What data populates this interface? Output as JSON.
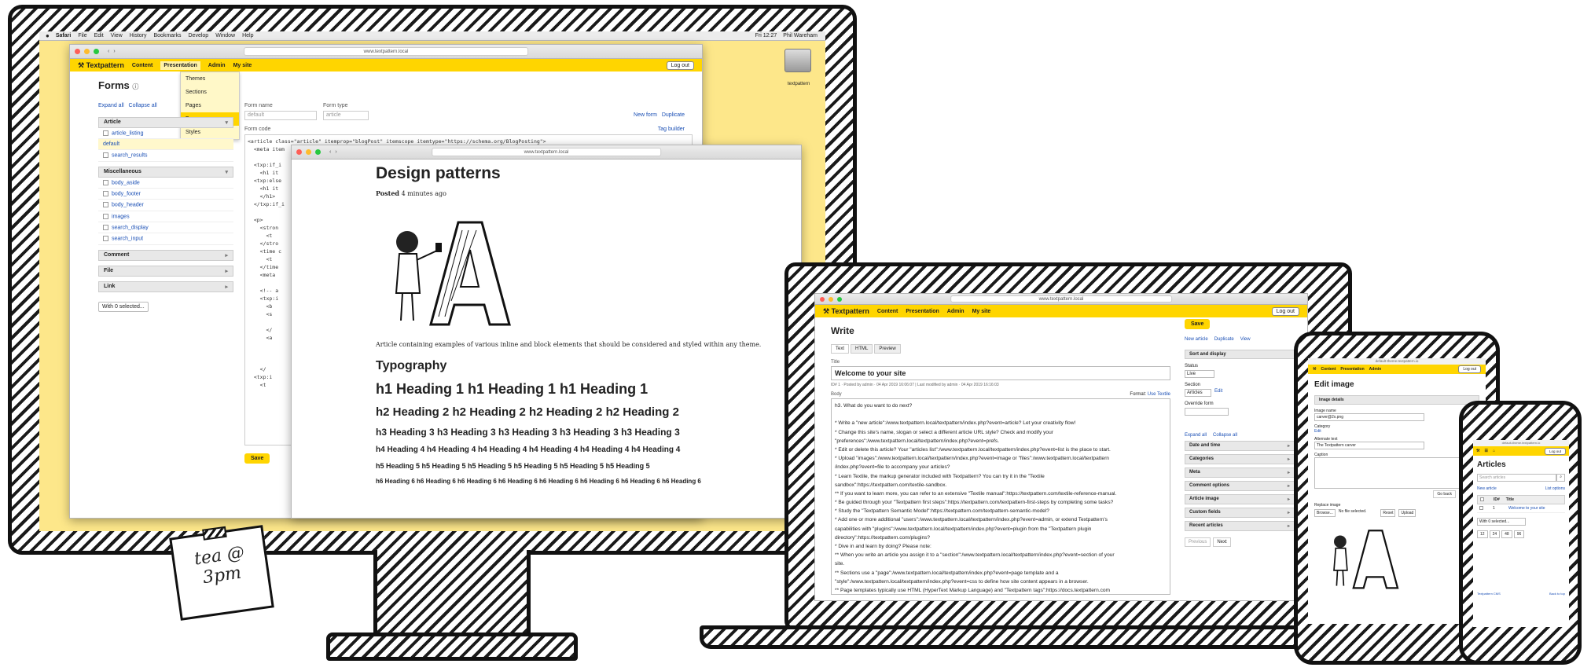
{
  "mac": {
    "menubar": [
      "Safari",
      "File",
      "Edit",
      "View",
      "History",
      "Bookmarks",
      "Develop",
      "Window",
      "Help"
    ],
    "clock": "Fri 12:27",
    "user": "Phil Wareham",
    "disk_label": "textpattern",
    "url_forms": "www.textpattern.local",
    "url_design": "www.textpattern.local"
  },
  "txp": {
    "logo": "Textpattern",
    "nav": [
      "Content",
      "Presentation",
      "Admin",
      "My site"
    ],
    "logout": "Log out",
    "presentation_menu": [
      "Themes",
      "Sections",
      "Pages",
      "Forms",
      "Styles"
    ]
  },
  "forms": {
    "title": "Forms",
    "expand_all": "Expand all",
    "collapse_all": "Collapse all",
    "groups": [
      {
        "name": "Article",
        "items": [
          "article_listing",
          "default",
          "search_results"
        ]
      },
      {
        "name": "Miscellaneous",
        "items": [
          "body_aside",
          "body_footer",
          "body_header",
          "images",
          "search_display",
          "search_input"
        ]
      },
      {
        "name": "Comment",
        "items": []
      },
      {
        "name": "File",
        "items": []
      },
      {
        "name": "Link",
        "items": []
      }
    ],
    "with_selected": "With 0 selected...",
    "form_name_label": "Form name",
    "form_name_value": "default",
    "form_type_label": "Form type",
    "form_type_value": "article",
    "new_form": "New form",
    "duplicate": "Duplicate",
    "form_code_label": "Form code",
    "tag_builder": "Tag builder",
    "code_lines": [
      "<article class=\"article\" itemprop=\"blogPost\" itemscope itemtype=\"https://schema.org/BlogPosting\">",
      "  <meta item",
      "",
      "  <txp:if_i",
      "    <h1 it",
      "  <txp:else",
      "    <h1 it",
      "    </h1>",
      "  </txp:if_i",
      "",
      "  <p>",
      "    <stron",
      "      <t",
      "    </stro",
      "    <time c",
      "      <t",
      "    </time",
      "    <meta",
      "",
      "    <!-- a",
      "    <txp:i",
      "      <b",
      "      <s",
      "",
      "      </",
      "      <a",
      "",
      "",
      "",
      "    </",
      "  <txp:i",
      "    <t"
    ],
    "save": "Save"
  },
  "design": {
    "title": "Design patterns",
    "posted_label": "Posted",
    "posted_time": "4 minutes ago",
    "excerpt": "Article containing examples of various inline and block elements that should be considered and styled within any theme.",
    "typography": "Typography",
    "h1": "h1 Heading 1 h1 Heading 1 h1 Heading 1",
    "h2": "h2 Heading 2 h2 Heading 2 h2 Heading 2 h2 Heading 2",
    "h3": "h3 Heading 3 h3 Heading 3 h3 Heading 3 h3 Heading 3 h3 Heading 3",
    "h4": "h4 Heading 4 h4 Heading 4 h4 Heading 4 h4 Heading 4 h4 Heading 4 h4 Heading 4",
    "h5": "h5 Heading 5 h5 Heading 5 h5 Heading 5 h5 Heading 5 h5 Heading 5 h5 Heading 5",
    "h6": "h6 Heading 6 h6 Heading 6 h6 Heading 6 h6 Heading 6 h6 Heading 6 h6 Heading 6 h6 Heading 6 h6 Heading 6"
  },
  "note": {
    "line1": "tea @",
    "line2": "3pm"
  },
  "write": {
    "url": "www.textpattern.local",
    "title": "Write",
    "tabs": [
      "Text",
      "HTML",
      "Preview"
    ],
    "title_label": "Title",
    "title_value": "Welcome to your site",
    "meta": "ID# 1 · Posted by admin · 04 Apr 2019 16:06:07 | Last modified by admin · 04 Apr 2019 16:16:03",
    "body_label": "Body",
    "format_label": "Format:",
    "format_value": "Use Textile",
    "body_lines": [
      "h3. What do you want to do next?",
      "",
      "* Write a \"new article\":/www.textpattern.local/textpattern/index.php?event=article? Let your creativity flow!",
      "* Change this site's name, slogan or select a different article URL style? Check and modify your",
      "\"preferences\":/www.textpattern.local/textpattern/index.php?event=prefs.",
      "* Edit or delete this article? Your \"articles list\":/www.textpattern.local/textpattern/index.php?event=list is the place to start.",
      "* Upload \"images\":/www.textpattern.local/textpattern/index.php?event=image or \"files\":/www.textpattern.local/textpattern",
      "/index.php?event=file to accompany your articles?",
      "* Learn Textile, the markup generator included with Textpattern? You can try it in the \"Textile",
      "sandbox\":https://textpattern.com/textile-sandbox.",
      "** If you want to learn more, you can refer to an extensive \"Textile manual\":https://textpattern.com/textile-reference-manual.",
      "* Be guided through your \"Textpattern first steps\":https://textpattern.com/textpattern-first-steps by completing some tasks?",
      "* Study the \"Textpattern Semantic Model\":https://textpattern.com/textpattern-semantic-model?",
      "* Add one or more additional \"users\":/www.textpattern.local/textpattern/index.php?event=admin, or extend Textpattern's",
      "capabilities with \"plugins\":/www.textpattern.local/textpattern/index.php?event=plugin from the \"Textpattern plugin",
      "directory\":https://textpattern.com/plugins?",
      "* Dive in and learn by doing? Please note:",
      "** When you write an article you assign it to a \"section\":/www.textpattern.local/textpattern/index.php?event=section of your",
      "site.",
      "** Sections use a \"page\":/www.textpattern.local/textpattern/index.php?event=page template and a",
      "\"style\":/www.textpattern.local/textpattern/index.php?event=css to define how site content appears in a browser.",
      "** Page templates typically use HTML (HyperText Markup Language) and \"Textpattern tags\":https://docs.textpattern.com"
    ],
    "save": "Save",
    "new_article": "New article",
    "duplicate": "Duplicate",
    "view": "View",
    "sort_display": "Sort and display",
    "status_label": "Status",
    "status_value": "Live",
    "section_label": "Section",
    "section_value": "Articles",
    "edit": "Edit",
    "override_label": "Override form",
    "expand_all": "Expand all",
    "collapse_all": "Collapse all",
    "panels": [
      "Date and time",
      "Categories",
      "Meta",
      "Comment options",
      "Article image",
      "Custom fields",
      "Recent articles"
    ],
    "previous": "Previous",
    "next": "Next"
  },
  "tablet": {
    "url": "default-theme.textpattern.io",
    "title": "Edit image",
    "image_details": "Image details",
    "image_name_label": "Image name",
    "image_name_value": "carver@2x.png",
    "category_label": "Category",
    "edit": "Edit",
    "alt_label": "Alternate text",
    "alt_value": "The Textpattern carver",
    "caption_label": "Caption",
    "go_back": "Go back",
    "replace_label": "Replace image",
    "browse": "Browse...",
    "no_file": "No file selected.",
    "reset": "Reset",
    "upload": "Upload"
  },
  "phone": {
    "url": "default-theme.textpattern.io",
    "title": "Articles",
    "search_placeholder": "Search articles",
    "new_article": "New article",
    "list_options": "List options",
    "col_id": "ID#",
    "col_title": "Title",
    "row_id": "1",
    "row_title": "Welcome to your site",
    "with_selected": "With 0 selected...",
    "pages": [
      "12",
      "24",
      "48",
      "96"
    ],
    "footer_left": "Textpattern CMS",
    "footer_right": "Back to top"
  }
}
